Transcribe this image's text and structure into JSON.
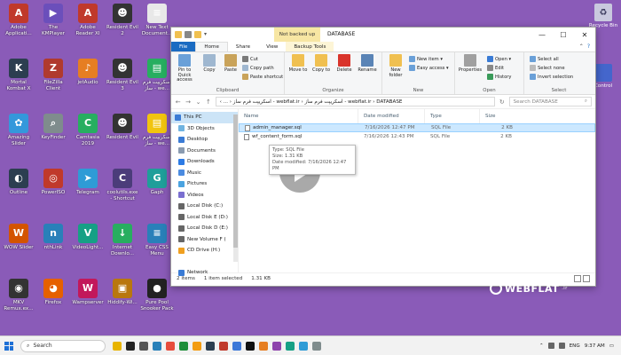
{
  "desktop": {
    "icons": [
      {
        "label": "Adobe Applicati...",
        "color": "#c0392b",
        "glyph": "A"
      },
      {
        "label": "The KMPlayer",
        "color": "#6b4fbb",
        "glyph": "▶"
      },
      {
        "label": "Adobe Reader XI",
        "color": "#c0392b",
        "glyph": "A"
      },
      {
        "label": "Resident Evil 2",
        "color": "#333333",
        "glyph": "☻"
      },
      {
        "label": "New Text Document...",
        "color": "#e8e8e8",
        "glyph": "≡"
      },
      {
        "label": "Mortal Kombat X",
        "color": "#2c3e50",
        "glyph": "K"
      },
      {
        "label": "FileZilla Client",
        "color": "#b03a2e",
        "glyph": "Z"
      },
      {
        "label": "jetAudio",
        "color": "#e67e22",
        "glyph": "♪"
      },
      {
        "label": "Resident Evil 3",
        "color": "#333333",
        "glyph": "☻"
      },
      {
        "label": "اسکریپت فرم ساز - we...",
        "color": "#27ae60",
        "glyph": "▤"
      },
      {
        "label": "Amazing Slider",
        "color": "#3498db",
        "glyph": "✿"
      },
      {
        "label": "KeyFinder",
        "color": "#7f8c8d",
        "glyph": "⌕"
      },
      {
        "label": "Camtasia 2019",
        "color": "#27ae60",
        "glyph": "C"
      },
      {
        "label": "Resident Evil",
        "color": "#333333",
        "glyph": "☻"
      },
      {
        "label": "اسکریپت فرم ساز - we...",
        "color": "#f1c40f",
        "glyph": "▤"
      },
      {
        "label": "Outline",
        "color": "#2c3e50",
        "glyph": "◐"
      },
      {
        "label": "PowerISO",
        "color": "#c0392b",
        "glyph": "◎"
      },
      {
        "label": "Telegram",
        "color": "#2e9bd6",
        "glyph": "➤"
      },
      {
        "label": "coolutils.exe - Shortcut",
        "color": "#4b3c7a",
        "glyph": "C"
      },
      {
        "label": "Gaph",
        "color": "#1f9e9a",
        "glyph": "G"
      },
      {
        "label": "WOW Slider",
        "color": "#d35400",
        "glyph": "W"
      },
      {
        "label": "nthLink",
        "color": "#2980b9",
        "glyph": "n"
      },
      {
        "label": "VideoLight...",
        "color": "#16a085",
        "glyph": "V"
      },
      {
        "label": "Internet Downlo...",
        "color": "#27ae60",
        "glyph": "↓"
      },
      {
        "label": "Easy CSS Menu",
        "color": "#2980b9",
        "glyph": "≡"
      },
      {
        "label": "MKV Remux.ex...",
        "color": "#333333",
        "glyph": "◉"
      },
      {
        "label": "Firefox",
        "color": "#e66000",
        "glyph": "◕"
      },
      {
        "label": "Wampserver",
        "color": "#c2185b",
        "glyph": "W"
      },
      {
        "label": "Hiddify-Wi...",
        "color": "#b9770e",
        "glyph": "▣"
      },
      {
        "label": "Pure Pool Snooker Pack",
        "color": "#222222",
        "glyph": "●"
      }
    ],
    "recycle_bin_label": "Recycle Bin",
    "control_label": "Control"
  },
  "window": {
    "context_tab": "Not backed up",
    "title": "DATABASE",
    "tabs": [
      "File",
      "Home",
      "Share",
      "View",
      "Backup Tools"
    ],
    "ribbon": {
      "clipboard": {
        "label": "Clipboard",
        "pin": "Pin to Quick access",
        "copy": "Copy",
        "paste": "Paste",
        "cut": "Cut",
        "copy_path": "Copy path",
        "paste_shortcut": "Paste shortcut"
      },
      "organize": {
        "label": "Organize",
        "move_to": "Move to",
        "copy_to": "Copy to",
        "delete": "Delete",
        "rename": "Rename"
      },
      "new": {
        "label": "New",
        "new_folder": "New folder",
        "new_item": "New item ▾",
        "easy_access": "Easy access ▾"
      },
      "open": {
        "label": "Open",
        "properties": "Properties",
        "open": "Open ▾",
        "edit": "Edit",
        "history": "History"
      },
      "select": {
        "label": "Select",
        "select_all": "Select all",
        "select_none": "Select none",
        "invert": "Invert selection"
      }
    },
    "address": "‹ ... › اسکریپت فرم ساز - webflat.ir › اسکریپت فرم ساز - webflat.ir › DATABASE",
    "search_placeholder": "Search DATABASE",
    "nav": [
      {
        "label": "This PC",
        "color": "#3a7bd5"
      },
      {
        "label": "3D Objects",
        "color": "#6fb3e0"
      },
      {
        "label": "Desktop",
        "color": "#3a7bd5"
      },
      {
        "label": "Documents",
        "color": "#8a9bb0"
      },
      {
        "label": "Downloads",
        "color": "#2c7be5"
      },
      {
        "label": "Music",
        "color": "#4b8be0"
      },
      {
        "label": "Pictures",
        "color": "#4ba3e0"
      },
      {
        "label": "Videos",
        "color": "#7a6fd0"
      },
      {
        "label": "Local Disk (C:)",
        "color": "#666666"
      },
      {
        "label": "Local Disk E (D:)",
        "color": "#666666"
      },
      {
        "label": "Local Disk D (E:)",
        "color": "#666666"
      },
      {
        "label": "New Volume F (",
        "color": "#666666"
      },
      {
        "label": "CD Drive (H:)",
        "color": "#f0a020"
      },
      {
        "label": "",
        "color": "transparent"
      },
      {
        "label": "Network",
        "color": "#3a7bd5"
      }
    ],
    "columns": [
      "Name",
      "Date modified",
      "Type",
      "Size"
    ],
    "files": [
      {
        "name": "admin_manager.sql",
        "date": "7/16/2026 12:47 PM",
        "type": "SQL File",
        "size": "2 KB"
      },
      {
        "name": "wf_content_form.sql",
        "date": "7/16/2026 12:43 PM",
        "type": "SQL File",
        "size": "2 KB"
      }
    ],
    "tooltip": {
      "type": "Type: SQL File",
      "size": "Size: 1.31 KB",
      "date": "Date modified: 7/16/2026 12:47 PM"
    },
    "status": {
      "items": "2 items",
      "selected": "1 item selected",
      "size": "1.31 KB"
    }
  },
  "watermark": {
    "text": "WEBFLAT",
    "sub": ".ir"
  },
  "taskbar": {
    "search": "Search",
    "apps": [
      "#e8b400",
      "#222222",
      "#555555",
      "#2980b9",
      "#e74c3c",
      "#1f8f3a",
      "#f39c12",
      "#2c3e50",
      "#c0392b",
      "#3c78d8",
      "#111111",
      "#e67e22",
      "#8e44ad",
      "#16a085",
      "#2e9bd6",
      "#7f8c8d"
    ],
    "lang": "ENG",
    "time": "9:37 AM"
  }
}
